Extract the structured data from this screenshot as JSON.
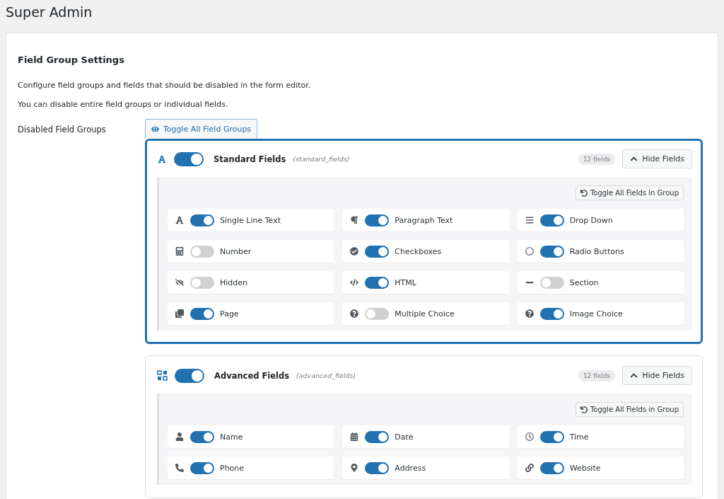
{
  "page_title": "Super Admin",
  "section": {
    "title": "Field Group Settings",
    "descriptions": [
      "Configure field groups and fields that should be disabled in the form editor.",
      "You can disable entire field groups or individual fields."
    ]
  },
  "disabled_field_groups": {
    "label": "Disabled Field Groups",
    "toggle_all_button": "Toggle All Field Groups",
    "groups": [
      {
        "name": "Standard Fields",
        "slug": "(standard_fields)",
        "on": true,
        "selected": true,
        "count": "12 fields",
        "hide_button": "Hide Fields",
        "toggle_group_button": "Toggle All Fields in Group",
        "fields": [
          {
            "label": "Single Line Text",
            "on": true
          },
          {
            "label": "Paragraph Text",
            "on": true
          },
          {
            "label": "Drop Down",
            "on": true
          },
          {
            "label": "Number",
            "on": false
          },
          {
            "label": "Checkboxes",
            "on": true
          },
          {
            "label": "Radio Buttons",
            "on": true
          },
          {
            "label": "Hidden",
            "on": false
          },
          {
            "label": "HTML",
            "on": true
          },
          {
            "label": "Section",
            "on": false
          },
          {
            "label": "Page",
            "on": true
          },
          {
            "label": "Multiple Choice",
            "on": false
          },
          {
            "label": "Image Choice",
            "on": true
          }
        ]
      },
      {
        "name": "Advanced Fields",
        "slug": "(advanced_fields)",
        "on": true,
        "selected": false,
        "count": "12 fields",
        "hide_button": "Hide Fields",
        "toggle_group_button": "Toggle All Fields in Group",
        "fields": [
          {
            "label": "Name",
            "on": true
          },
          {
            "label": "Date",
            "on": true
          },
          {
            "label": "Time",
            "on": true
          },
          {
            "label": "Phone",
            "on": true
          },
          {
            "label": "Address",
            "on": true
          },
          {
            "label": "Website",
            "on": true
          }
        ]
      }
    ]
  }
}
